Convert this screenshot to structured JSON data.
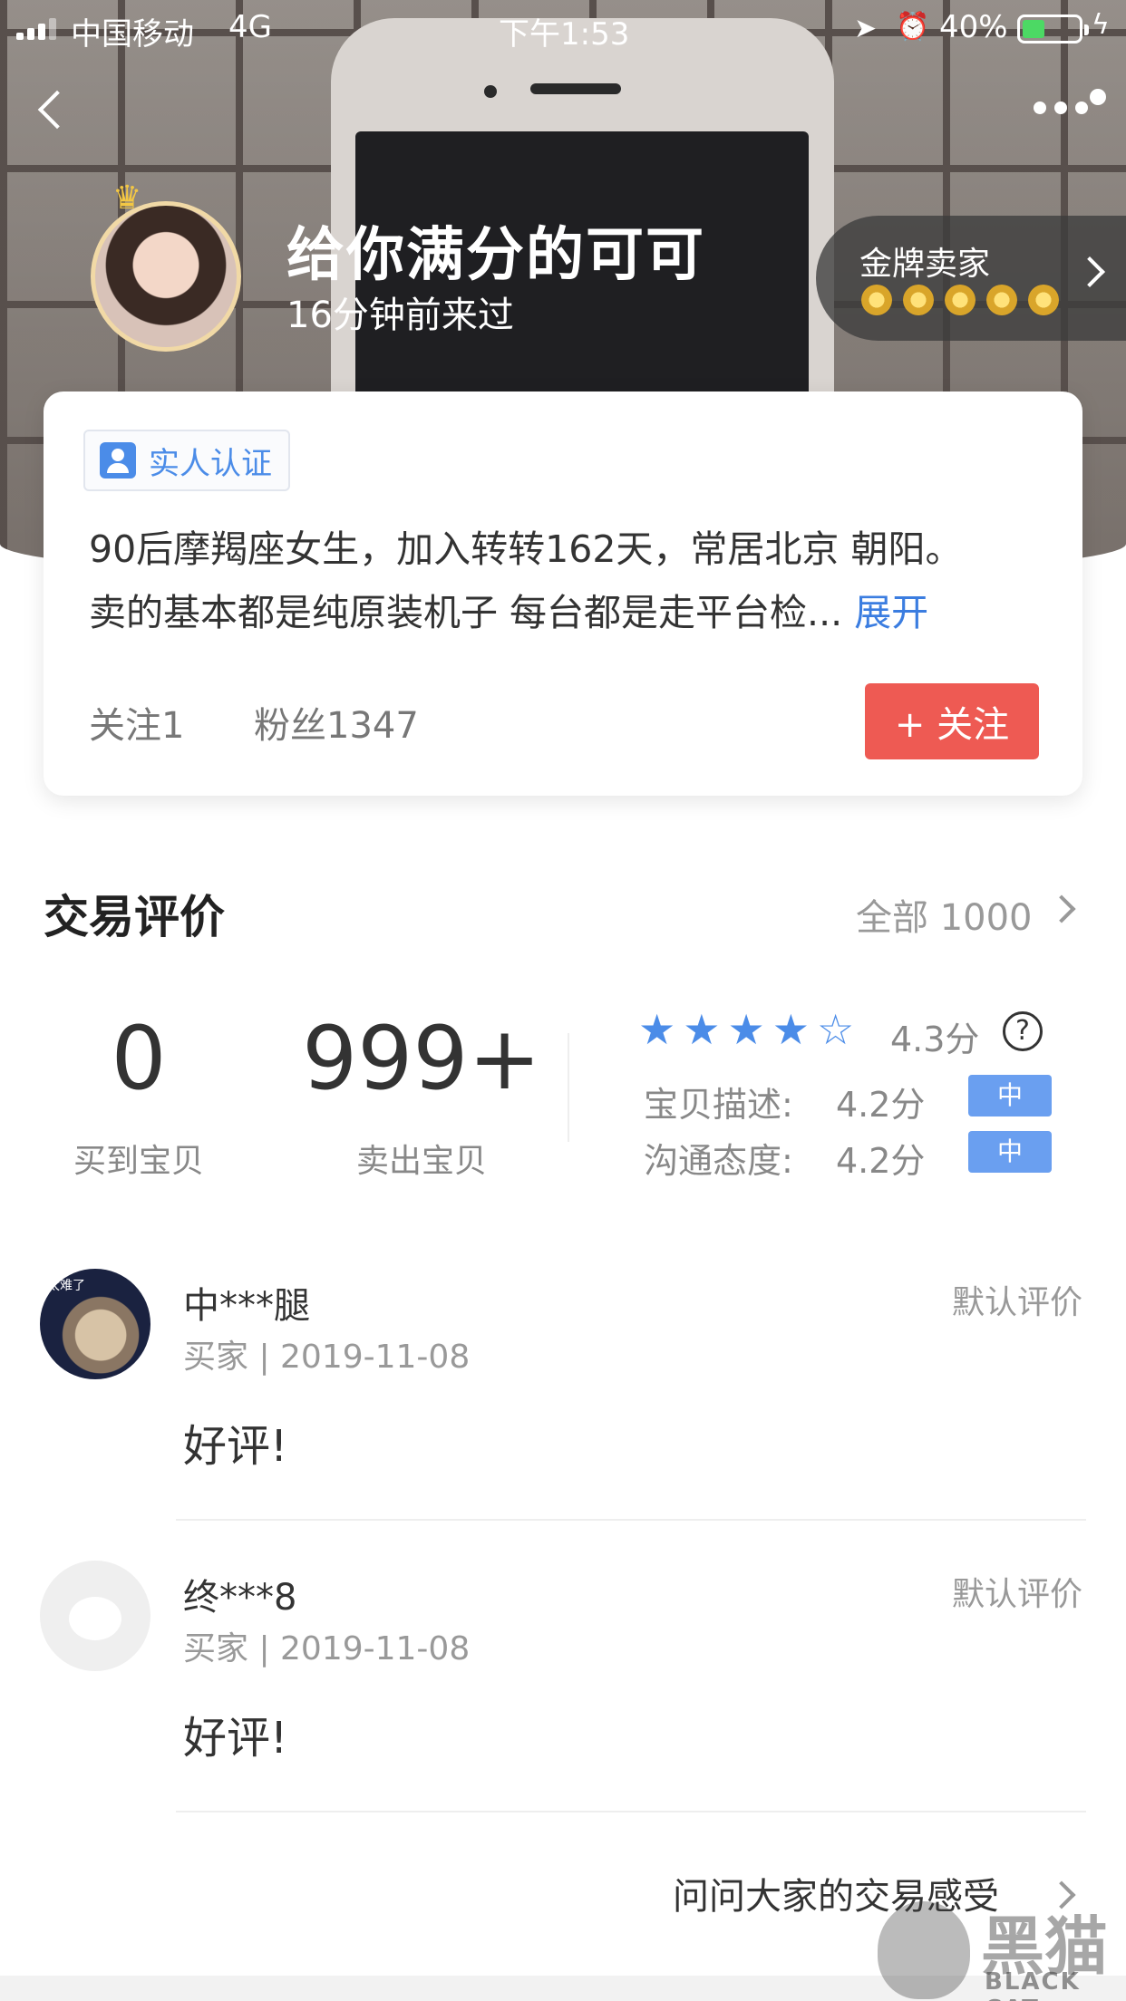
{
  "status_bar": {
    "carrier": "中国移动",
    "network": "4G",
    "time": "下午1:53",
    "battery": "40%",
    "battery_level": 0.4
  },
  "profile": {
    "username": "给你满分的可可",
    "last_visit": "16分钟前来过",
    "gold_badge_title": "金牌卖家",
    "gold_medals": 5
  },
  "info_card": {
    "verify_label": "实人认证",
    "bio_line1": "90后摩羯座女生，加入转转162天，常居北京 朝阳。",
    "bio_line2": "卖的基本都是纯原装机子 每台都是走平台检...",
    "expand_label": "展开",
    "following": "关注1",
    "fans": "粉丝1347",
    "follow_button": "+ 关注"
  },
  "reviews": {
    "title": "交易评价",
    "all_label": "全部 1000",
    "bought_count": "0",
    "bought_label": "买到宝贝",
    "sold_count": "999+",
    "sold_label": "卖出宝贝",
    "stars_full": 4,
    "stars_total": 5,
    "overall_score": "4.3分",
    "desc_label": "宝贝描述:",
    "desc_score": "4.2分",
    "desc_level": "中",
    "comm_label": "沟通态度:",
    "comm_score": "4.2分",
    "comm_level": "中",
    "items": [
      {
        "name": "中***腿",
        "type": "默认评价",
        "meta": "买家 | 2019-11-08",
        "text": "好评!",
        "avatar_text": "太难了"
      },
      {
        "name": "终***8",
        "type": "默认评价",
        "meta": "买家 | 2019-11-08",
        "text": "好评!"
      }
    ],
    "ask_link": "问问大家的交易感受"
  },
  "watermark": {
    "text": "黑猫",
    "sub": "BLACK CAT"
  }
}
